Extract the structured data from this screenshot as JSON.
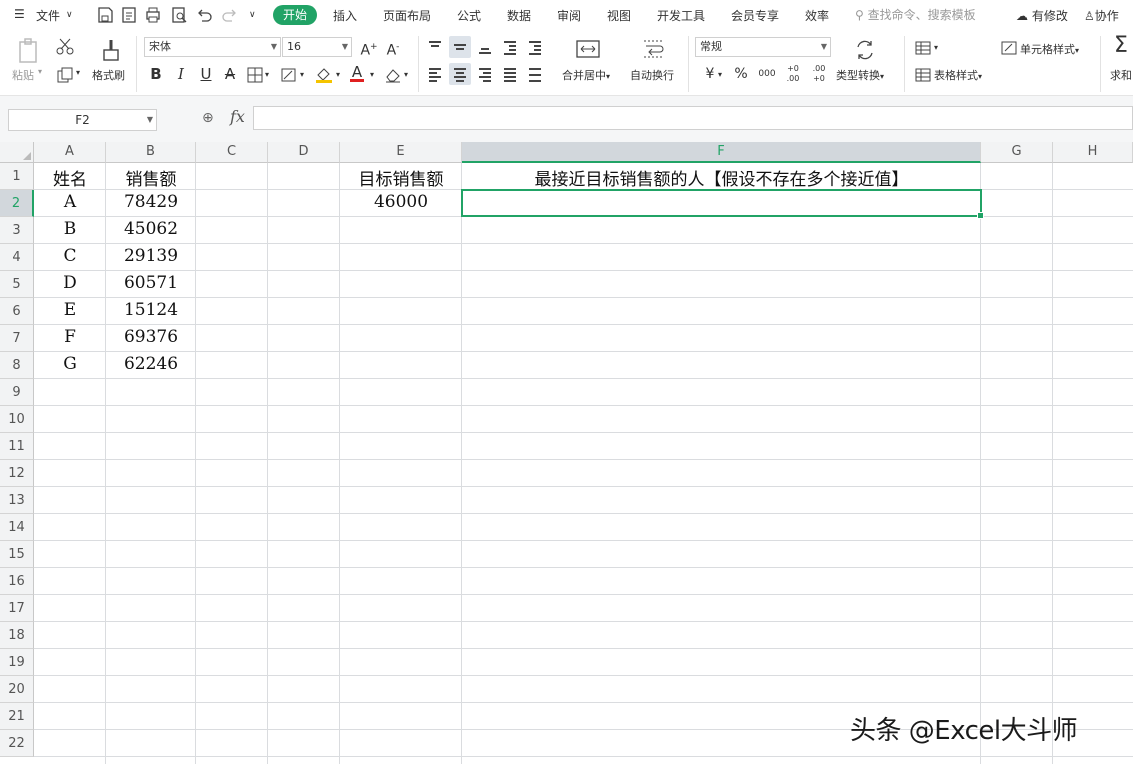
{
  "menubar": {
    "file": "文件",
    "tabs": [
      {
        "label": "开始",
        "active": true
      },
      {
        "label": "插入"
      },
      {
        "label": "页面布局"
      },
      {
        "label": "公式"
      },
      {
        "label": "数据"
      },
      {
        "label": "审阅"
      },
      {
        "label": "视图"
      },
      {
        "label": "开发工具"
      },
      {
        "label": "会员专享"
      },
      {
        "label": "效率"
      }
    ],
    "search_placeholder": "查找命令、搜索模板",
    "changes": "有修改",
    "collab": "协作",
    "accent": "#21a366"
  },
  "ribbon": {
    "paste": "粘贴",
    "format_painter": "格式刷",
    "font_name": "宋体",
    "font_size": "16",
    "merge_center": "合并居中",
    "wrap_text": "自动换行",
    "number_format": "常规",
    "type_convert": "类型转换",
    "cell_style": "单元格样式",
    "table_style": "表格样式",
    "sum": "求和",
    "currency": "¥",
    "percent": "%",
    "thousands": "000",
    "inc_decimal": "+0 .00",
    "dec_decimal": ".00 +0",
    "bold": "B",
    "italic": "I",
    "underline": "U",
    "font_color": "A",
    "font_color_hex": "#e02020",
    "fill_color_hex": "#f5c400"
  },
  "formula_bar": {
    "name_box": "F2",
    "fx": "fx",
    "formula": ""
  },
  "sheet": {
    "columns": [
      "A",
      "B",
      "C",
      "D",
      "E",
      "F",
      "G",
      "H"
    ],
    "rows": [
      "1",
      "2",
      "3",
      "4",
      "5",
      "6",
      "7",
      "8",
      "9",
      "10",
      "11",
      "12",
      "13",
      "14",
      "15",
      "16",
      "17",
      "18",
      "19",
      "20",
      "21",
      "22"
    ],
    "selected_cell": "F2",
    "header": {
      "name": "姓名",
      "sales": "销售额",
      "target_label": "目标销售额",
      "result_label": "最接近目标销售额的人【假设不存在多个接近值】"
    },
    "target_value": "46000",
    "data": [
      {
        "name": "A",
        "sales": "78429"
      },
      {
        "name": "B",
        "sales": "45062"
      },
      {
        "name": "C",
        "sales": "29139"
      },
      {
        "name": "D",
        "sales": "60571"
      },
      {
        "name": "E",
        "sales": "15124"
      },
      {
        "name": "F",
        "sales": "69376"
      },
      {
        "name": "G",
        "sales": "62246"
      }
    ]
  },
  "watermark": "头条 @Excel大斗师"
}
